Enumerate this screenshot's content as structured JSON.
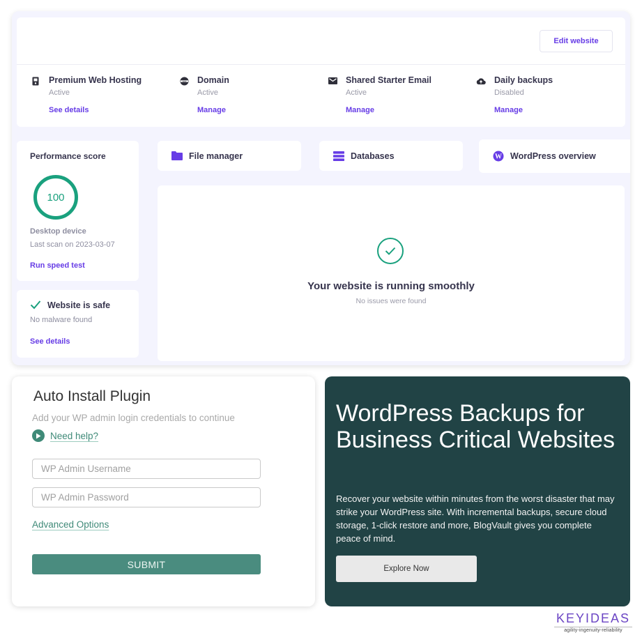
{
  "dashboard": {
    "edit_website_label": "Edit website",
    "services": [
      {
        "icon": "server-icon",
        "title": "Premium Web Hosting",
        "status": "Active",
        "link": "See details"
      },
      {
        "icon": "globe-icon",
        "title": "Domain",
        "status": "Active",
        "link": "Manage"
      },
      {
        "icon": "mail-icon",
        "title": "Shared Starter Email",
        "status": "Active",
        "link": "Manage"
      },
      {
        "icon": "cloud-upload-icon",
        "title": "Daily backups",
        "status": "Disabled",
        "link": "Manage"
      }
    ],
    "performance": {
      "title": "Performance score",
      "score": "100",
      "device": "Desktop device",
      "last_scan": "Last scan on 2023-03-07",
      "link": "Run speed test"
    },
    "security": {
      "title": "Website is safe",
      "subtitle": "No malware found",
      "link": "See details"
    },
    "tools": [
      {
        "icon": "folder-icon",
        "label": "File manager"
      },
      {
        "icon": "database-icon",
        "label": "Databases"
      },
      {
        "icon": "wordpress-icon",
        "label": "WordPress overview"
      }
    ],
    "status": {
      "title": "Your website is running smoothly",
      "subtitle": "No issues were found"
    },
    "colors": {
      "accent": "#673de6",
      "success": "#1aa17e",
      "background": "#f4f4fe"
    }
  },
  "plugin": {
    "title": "Auto Install Plugin",
    "subtitle": "Add your WP admin login credentials to continue",
    "help_label": "Need help?",
    "username_placeholder": "WP Admin Username",
    "username_value": "",
    "password_placeholder": "WP Admin Password",
    "password_value": "",
    "advanced_label": "Advanced Options",
    "submit_label": "SUBMIT",
    "colors": {
      "primary": "#4a8c7f"
    }
  },
  "promo": {
    "title": "WordPress Backups for Business Critical Websites",
    "body": "Recover your website within minutes from the worst disaster that may strike your WordPress site. With incremental backups, secure cloud storage, 1-click restore and more, BlogVault gives you complete peace of mind.",
    "button_label": "Explore Now",
    "colors": {
      "background": "#214345"
    }
  },
  "logo": {
    "name": "KEYIDEAS",
    "tagline": "agility-ingenuity-reliability"
  }
}
